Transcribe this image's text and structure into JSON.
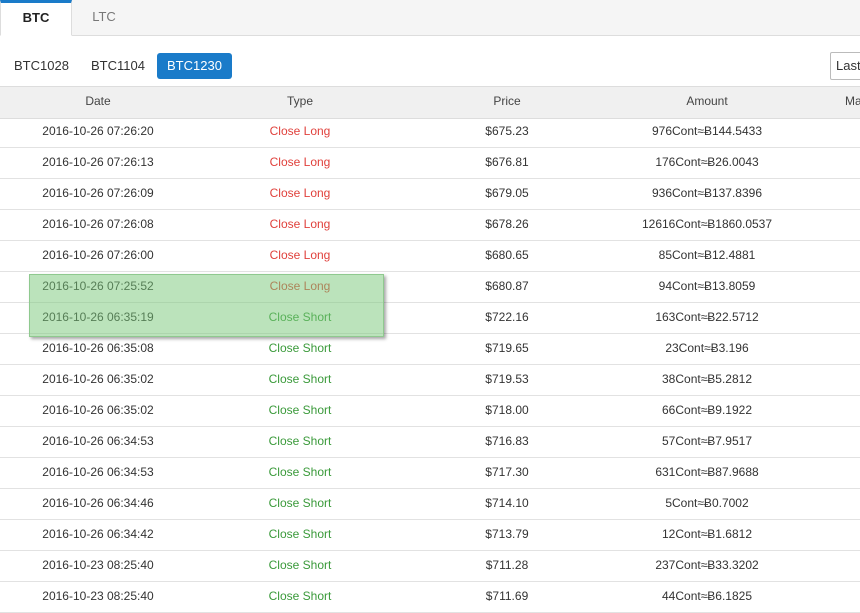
{
  "tabs": [
    {
      "label": "BTC",
      "active": true
    },
    {
      "label": "LTC",
      "active": false
    }
  ],
  "contracts": [
    {
      "label": "BTC1028",
      "active": false
    },
    {
      "label": "BTC1104",
      "active": false
    },
    {
      "label": "BTC1230",
      "active": true
    }
  ],
  "filter": {
    "value": "Last"
  },
  "columns": {
    "date": "Date",
    "type": "Type",
    "price": "Price",
    "amount": "Amount",
    "extra": "Ma"
  },
  "rows": [
    {
      "date": "2016-10-26 07:26:20",
      "type": "Close Long",
      "side": "long",
      "price": "$675.23",
      "amount": "976Cont≈Ƀ144.5433"
    },
    {
      "date": "2016-10-26 07:26:13",
      "type": "Close Long",
      "side": "long",
      "price": "$676.81",
      "amount": "176Cont≈Ƀ26.0043"
    },
    {
      "date": "2016-10-26 07:26:09",
      "type": "Close Long",
      "side": "long",
      "price": "$679.05",
      "amount": "936Cont≈Ƀ137.8396"
    },
    {
      "date": "2016-10-26 07:26:08",
      "type": "Close Long",
      "side": "long",
      "price": "$678.26",
      "amount": "12616Cont≈Ƀ1860.0537"
    },
    {
      "date": "2016-10-26 07:26:00",
      "type": "Close Long",
      "side": "long",
      "price": "$680.65",
      "amount": "85Cont≈Ƀ12.4881"
    },
    {
      "date": "2016-10-26 07:25:52",
      "type": "Close Long",
      "side": "long",
      "price": "$680.87",
      "amount": "94Cont≈Ƀ13.8059"
    },
    {
      "date": "2016-10-26 06:35:19",
      "type": "Close Short",
      "side": "short",
      "price": "$722.16",
      "amount": "163Cont≈Ƀ22.5712"
    },
    {
      "date": "2016-10-26 06:35:08",
      "type": "Close Short",
      "side": "short",
      "price": "$719.65",
      "amount": "23Cont≈Ƀ3.196"
    },
    {
      "date": "2016-10-26 06:35:02",
      "type": "Close Short",
      "side": "short",
      "price": "$719.53",
      "amount": "38Cont≈Ƀ5.2812"
    },
    {
      "date": "2016-10-26 06:35:02",
      "type": "Close Short",
      "side": "short",
      "price": "$718.00",
      "amount": "66Cont≈Ƀ9.1922"
    },
    {
      "date": "2016-10-26 06:34:53",
      "type": "Close Short",
      "side": "short",
      "price": "$716.83",
      "amount": "57Cont≈Ƀ7.9517"
    },
    {
      "date": "2016-10-26 06:34:53",
      "type": "Close Short",
      "side": "short",
      "price": "$717.30",
      "amount": "631Cont≈Ƀ87.9688"
    },
    {
      "date": "2016-10-26 06:34:46",
      "type": "Close Short",
      "side": "short",
      "price": "$714.10",
      "amount": "5Cont≈Ƀ0.7002"
    },
    {
      "date": "2016-10-26 06:34:42",
      "type": "Close Short",
      "side": "short",
      "price": "$713.79",
      "amount": "12Cont≈Ƀ1.6812"
    },
    {
      "date": "2016-10-23 08:25:40",
      "type": "Close Short",
      "side": "short",
      "price": "$711.28",
      "amount": "237Cont≈Ƀ33.3202"
    },
    {
      "date": "2016-10-23 08:25:40",
      "type": "Close Short",
      "side": "short",
      "price": "$711.69",
      "amount": "44Cont≈Ƀ6.1825"
    }
  ],
  "colors": {
    "accent": "#1a7bc9",
    "long": "#e0413c",
    "short": "#3a9a3a",
    "selection": "#8fc98f"
  }
}
